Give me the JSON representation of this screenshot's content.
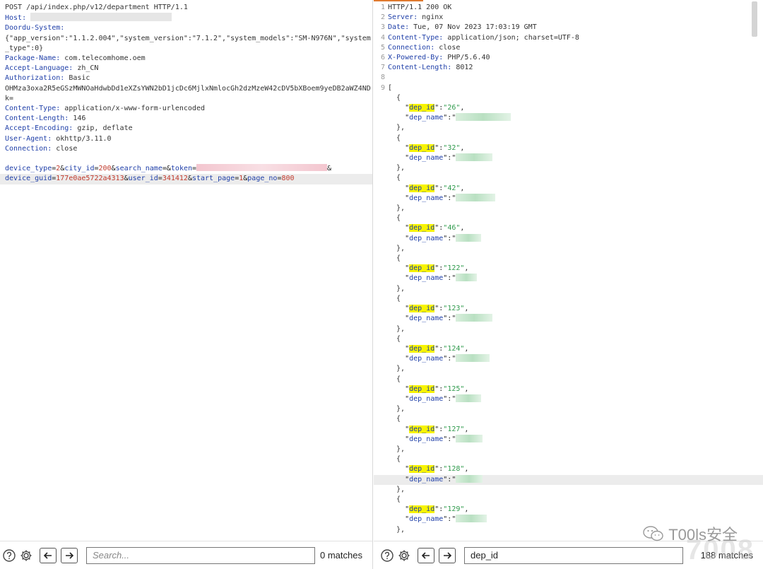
{
  "request": {
    "lines": [
      {
        "key": "",
        "value": "POST /api/index.php/v12/department HTTP/1.1",
        "plain": true
      },
      {
        "key": "Host:",
        "value": "",
        "redact": 200
      },
      {
        "key": "Doordu-System:",
        "value": ""
      },
      {
        "key": "",
        "value": "{\"app_version\":\"1.1.2.004\",\"system_version\":\"7.1.2\",\"system_models\":\"SM-N976N\",\"system",
        "plain": true
      },
      {
        "key": "",
        "value": "_type\":0}",
        "plain": true
      },
      {
        "key": "Package-Name:",
        "value": " com.telecomhome.oem"
      },
      {
        "key": "Accept-Language:",
        "value": " zh_CN"
      },
      {
        "key": "Authorization:",
        "value": " Basic"
      },
      {
        "key": "",
        "value": "OHMza3oxa2R5eGSzMWNOaHdwbDd1eXZsYWN2bD1jcDc6MjlxNmlocGh2dzMzeW42cDV5bXBoem9yeDB2aWZ4ND",
        "plain": true
      },
      {
        "key": "",
        "value": "k=",
        "plain": true
      },
      {
        "key": "Content-Type:",
        "value": " application/x-www-form-urlencoded"
      },
      {
        "key": "Content-Length:",
        "value": " 146"
      },
      {
        "key": "Accept-Encoding:",
        "value": " gzip, deflate"
      },
      {
        "key": "User-Agent:",
        "value": " okhttp/3.11.0"
      },
      {
        "key": "Connection:",
        "value": " close"
      }
    ],
    "body_line1": [
      {
        "k": "device_type",
        "v": "2"
      },
      {
        "k": "city_id",
        "v": "200"
      },
      {
        "k": "search_name",
        "v": ""
      },
      {
        "k": "token",
        "v": "",
        "redact": true
      }
    ],
    "body_line2": [
      {
        "k": "device_guid",
        "v": "177e0ae5722a4313"
      },
      {
        "k": "user_id",
        "v": "341412"
      },
      {
        "k": "start_page",
        "v": "1"
      },
      {
        "k": "page_no",
        "v": "800"
      }
    ]
  },
  "response": {
    "headers": [
      {
        "n": "1",
        "key": "",
        "value": "HTTP/1.1 200 OK"
      },
      {
        "n": "2",
        "key": "Server:",
        "value": " nginx"
      },
      {
        "n": "3",
        "key": "Date:",
        "value": " Tue, 07 Nov 2023 17:03:19 GMT"
      },
      {
        "n": "4",
        "key": "Content-Type:",
        "value": " application/json; charset=UTF-8"
      },
      {
        "n": "5",
        "key": "Connection:",
        "value": " close"
      },
      {
        "n": "6",
        "key": "X-Powered-By:",
        "value": " PHP/5.6.40"
      },
      {
        "n": "7",
        "key": "Content-Length:",
        "value": " 8012"
      },
      {
        "n": "8",
        "key": "",
        "value": ""
      },
      {
        "n": "9",
        "key": "",
        "value": "["
      }
    ],
    "id_key": "dep_id",
    "name_key": "dep_name",
    "items": [
      {
        "id": "26",
        "redact": 78
      },
      {
        "id": "32",
        "redact": 52
      },
      {
        "id": "42",
        "redact": 56
      },
      {
        "id": "46",
        "redact": 36
      },
      {
        "id": "122",
        "redact": 30
      },
      {
        "id": "123",
        "redact": 52
      },
      {
        "id": "124",
        "redact": 48
      },
      {
        "id": "125",
        "redact": 36
      },
      {
        "id": "127",
        "redact": 38
      },
      {
        "id": "128",
        "redact": 38,
        "selected": true
      },
      {
        "id": "129",
        "redact": 44
      }
    ]
  },
  "left_footer": {
    "search_placeholder": "Search...",
    "search_value": "",
    "matches": "0 matches"
  },
  "right_footer": {
    "search_placeholder": "",
    "search_value": "dep_id",
    "matches": "188 matches"
  },
  "watermark": {
    "text": "T00ls安全",
    "bg_text": "7008"
  },
  "icons": {
    "help": "help-circle-icon",
    "settings": "gear-icon",
    "prev": "arrow-left-icon",
    "next": "arrow-right-icon",
    "wechat": "wechat-icon"
  }
}
